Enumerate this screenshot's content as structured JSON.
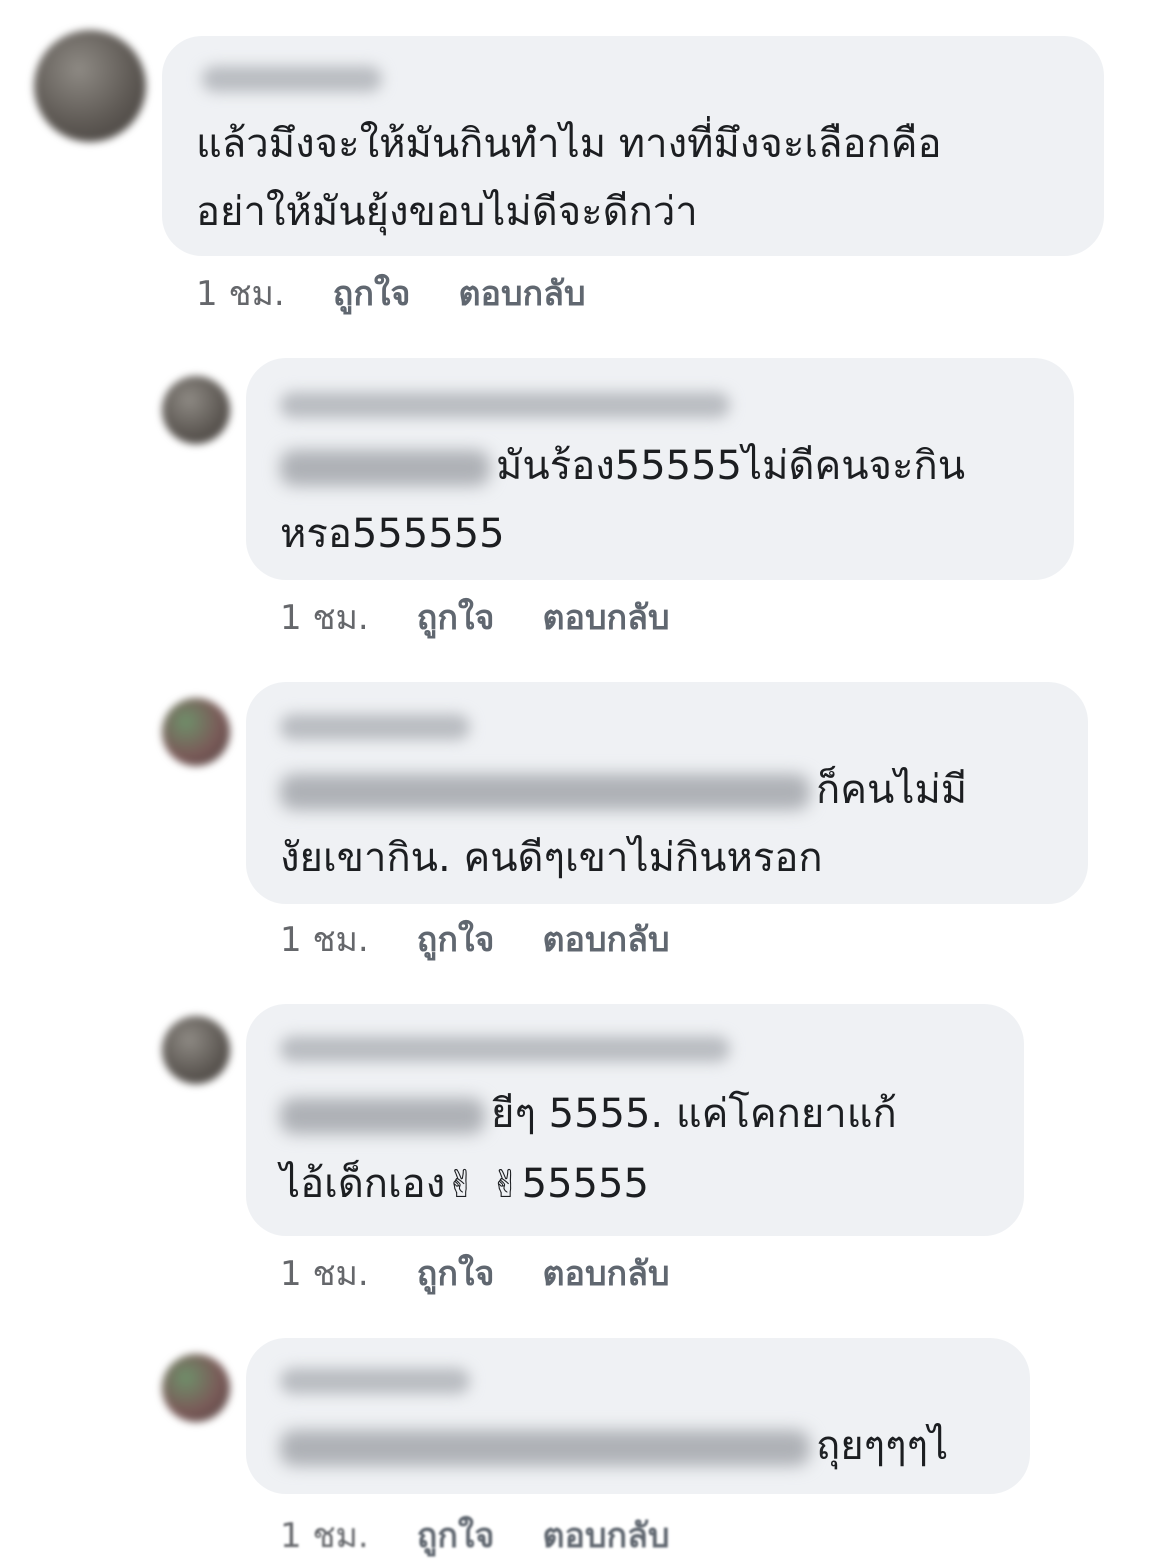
{
  "comments": [
    {
      "lines": [
        "แล้วมึงจะให้มันกินทำไม ทางที่มึงจะเลือกคือ",
        "อย่าให้มันยุ้งขอบไม่ดีจะดีกว่า"
      ],
      "time": "1 ชม.",
      "like": "ถูกใจ",
      "reply": "ตอบกลับ"
    },
    {
      "line1": "มันร้อง55555ไม่ดีคนจะกิน",
      "line2": "หรอ555555",
      "time": "1 ชม.",
      "like": "ถูกใจ",
      "reply": "ตอบกลับ"
    },
    {
      "line1": "ก็คนไม่มี",
      "line2": "งัยเขากิน. คนดีๆเขาไม่กินหรอก",
      "time": "1 ชม.",
      "like": "ถูกใจ",
      "reply": "ตอบกลับ"
    },
    {
      "line1": "ยีๆ 5555. แค่โคกยาแก้",
      "line2_text": "ไอ้เด็กเอง",
      "emoji": "✌",
      "line2_end": "55555",
      "time": "1 ชม.",
      "like": "ถูกใจ",
      "reply": "ตอบกลับ"
    },
    {
      "line1": "ถุยๆๆๆไ",
      "time": "1 ชม.",
      "like": "ถูกใจ",
      "reply": "ตอบกลับ"
    }
  ]
}
